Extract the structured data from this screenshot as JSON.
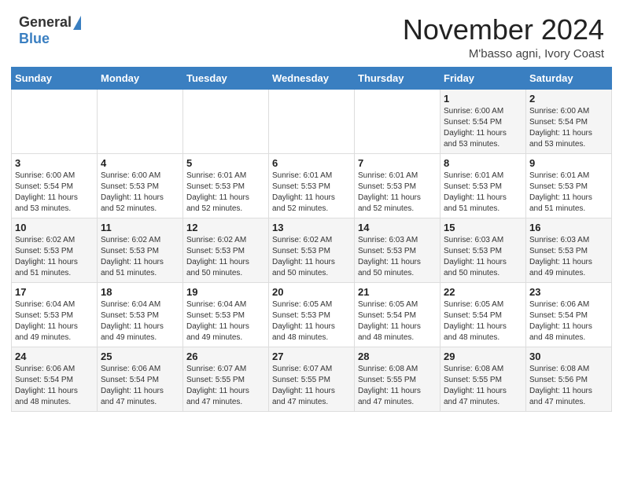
{
  "header": {
    "logo_general": "General",
    "logo_blue": "Blue",
    "title": "November 2024",
    "location": "M'basso agni, Ivory Coast"
  },
  "days_of_week": [
    "Sunday",
    "Monday",
    "Tuesday",
    "Wednesday",
    "Thursday",
    "Friday",
    "Saturday"
  ],
  "weeks": [
    [
      {
        "day": "",
        "info": ""
      },
      {
        "day": "",
        "info": ""
      },
      {
        "day": "",
        "info": ""
      },
      {
        "day": "",
        "info": ""
      },
      {
        "day": "",
        "info": ""
      },
      {
        "day": "1",
        "info": "Sunrise: 6:00 AM\nSunset: 5:54 PM\nDaylight: 11 hours\nand 53 minutes."
      },
      {
        "day": "2",
        "info": "Sunrise: 6:00 AM\nSunset: 5:54 PM\nDaylight: 11 hours\nand 53 minutes."
      }
    ],
    [
      {
        "day": "3",
        "info": "Sunrise: 6:00 AM\nSunset: 5:54 PM\nDaylight: 11 hours\nand 53 minutes."
      },
      {
        "day": "4",
        "info": "Sunrise: 6:00 AM\nSunset: 5:53 PM\nDaylight: 11 hours\nand 52 minutes."
      },
      {
        "day": "5",
        "info": "Sunrise: 6:01 AM\nSunset: 5:53 PM\nDaylight: 11 hours\nand 52 minutes."
      },
      {
        "day": "6",
        "info": "Sunrise: 6:01 AM\nSunset: 5:53 PM\nDaylight: 11 hours\nand 52 minutes."
      },
      {
        "day": "7",
        "info": "Sunrise: 6:01 AM\nSunset: 5:53 PM\nDaylight: 11 hours\nand 52 minutes."
      },
      {
        "day": "8",
        "info": "Sunrise: 6:01 AM\nSunset: 5:53 PM\nDaylight: 11 hours\nand 51 minutes."
      },
      {
        "day": "9",
        "info": "Sunrise: 6:01 AM\nSunset: 5:53 PM\nDaylight: 11 hours\nand 51 minutes."
      }
    ],
    [
      {
        "day": "10",
        "info": "Sunrise: 6:02 AM\nSunset: 5:53 PM\nDaylight: 11 hours\nand 51 minutes."
      },
      {
        "day": "11",
        "info": "Sunrise: 6:02 AM\nSunset: 5:53 PM\nDaylight: 11 hours\nand 51 minutes."
      },
      {
        "day": "12",
        "info": "Sunrise: 6:02 AM\nSunset: 5:53 PM\nDaylight: 11 hours\nand 50 minutes."
      },
      {
        "day": "13",
        "info": "Sunrise: 6:02 AM\nSunset: 5:53 PM\nDaylight: 11 hours\nand 50 minutes."
      },
      {
        "day": "14",
        "info": "Sunrise: 6:03 AM\nSunset: 5:53 PM\nDaylight: 11 hours\nand 50 minutes."
      },
      {
        "day": "15",
        "info": "Sunrise: 6:03 AM\nSunset: 5:53 PM\nDaylight: 11 hours\nand 50 minutes."
      },
      {
        "day": "16",
        "info": "Sunrise: 6:03 AM\nSunset: 5:53 PM\nDaylight: 11 hours\nand 49 minutes."
      }
    ],
    [
      {
        "day": "17",
        "info": "Sunrise: 6:04 AM\nSunset: 5:53 PM\nDaylight: 11 hours\nand 49 minutes."
      },
      {
        "day": "18",
        "info": "Sunrise: 6:04 AM\nSunset: 5:53 PM\nDaylight: 11 hours\nand 49 minutes."
      },
      {
        "day": "19",
        "info": "Sunrise: 6:04 AM\nSunset: 5:53 PM\nDaylight: 11 hours\nand 49 minutes."
      },
      {
        "day": "20",
        "info": "Sunrise: 6:05 AM\nSunset: 5:53 PM\nDaylight: 11 hours\nand 48 minutes."
      },
      {
        "day": "21",
        "info": "Sunrise: 6:05 AM\nSunset: 5:54 PM\nDaylight: 11 hours\nand 48 minutes."
      },
      {
        "day": "22",
        "info": "Sunrise: 6:05 AM\nSunset: 5:54 PM\nDaylight: 11 hours\nand 48 minutes."
      },
      {
        "day": "23",
        "info": "Sunrise: 6:06 AM\nSunset: 5:54 PM\nDaylight: 11 hours\nand 48 minutes."
      }
    ],
    [
      {
        "day": "24",
        "info": "Sunrise: 6:06 AM\nSunset: 5:54 PM\nDaylight: 11 hours\nand 48 minutes."
      },
      {
        "day": "25",
        "info": "Sunrise: 6:06 AM\nSunset: 5:54 PM\nDaylight: 11 hours\nand 47 minutes."
      },
      {
        "day": "26",
        "info": "Sunrise: 6:07 AM\nSunset: 5:55 PM\nDaylight: 11 hours\nand 47 minutes."
      },
      {
        "day": "27",
        "info": "Sunrise: 6:07 AM\nSunset: 5:55 PM\nDaylight: 11 hours\nand 47 minutes."
      },
      {
        "day": "28",
        "info": "Sunrise: 6:08 AM\nSunset: 5:55 PM\nDaylight: 11 hours\nand 47 minutes."
      },
      {
        "day": "29",
        "info": "Sunrise: 6:08 AM\nSunset: 5:55 PM\nDaylight: 11 hours\nand 47 minutes."
      },
      {
        "day": "30",
        "info": "Sunrise: 6:08 AM\nSunset: 5:56 PM\nDaylight: 11 hours\nand 47 minutes."
      }
    ]
  ]
}
